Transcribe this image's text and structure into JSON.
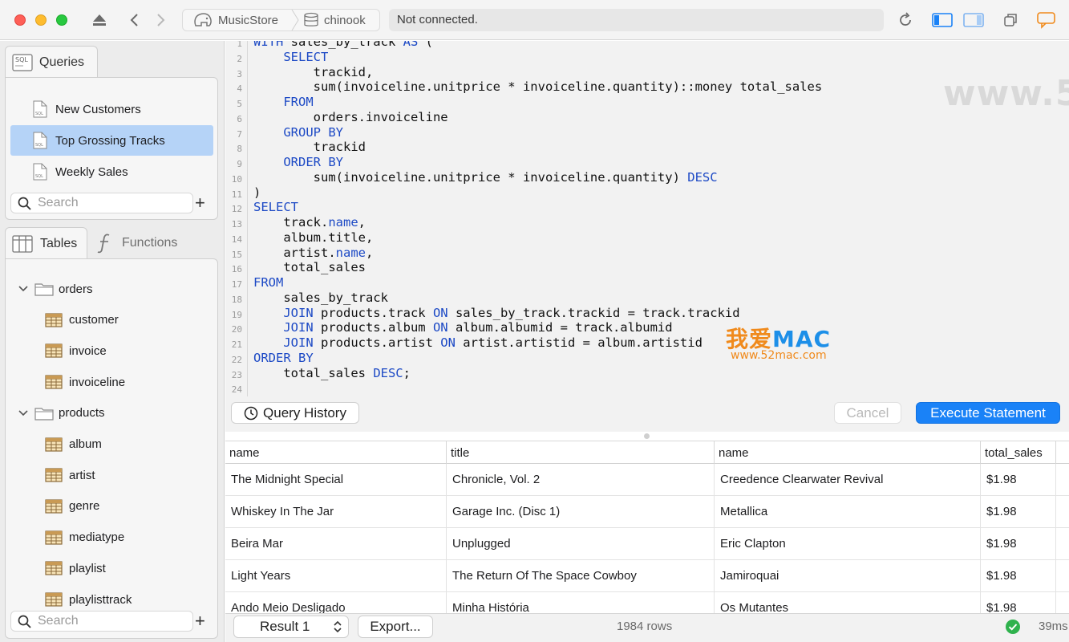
{
  "toolbar": {
    "breadcrumb": {
      "server": "MusicStore",
      "database": "chinook"
    },
    "status": "Not connected."
  },
  "watermarks": {
    "site": "www.52mac.com",
    "logo_cn": "我爱",
    "logo_en": "MAC",
    "logo_sub": "www.52mac.com"
  },
  "sidebar": {
    "queries_tab": "Queries",
    "queries": [
      {
        "label": "New Customers",
        "selected": false
      },
      {
        "label": "Top Grossing Tracks",
        "selected": true
      },
      {
        "label": "Weekly Sales",
        "selected": false
      }
    ],
    "queries_search_placeholder": "Search",
    "tables_tab": "Tables",
    "functions_tab": "Functions",
    "tree": [
      {
        "type": "folder",
        "label": "orders"
      },
      {
        "type": "table",
        "label": "customer"
      },
      {
        "type": "table",
        "label": "invoice"
      },
      {
        "type": "table",
        "label": "invoiceline"
      },
      {
        "type": "folder",
        "label": "products"
      },
      {
        "type": "table",
        "label": "album"
      },
      {
        "type": "table",
        "label": "artist"
      },
      {
        "type": "table",
        "label": "genre"
      },
      {
        "type": "table",
        "label": "mediatype"
      },
      {
        "type": "table",
        "label": "playlist"
      },
      {
        "type": "table",
        "label": "playlisttrack"
      }
    ],
    "tables_search_placeholder": "Search"
  },
  "editor": {
    "line_numbers": [
      "1",
      "2",
      "3",
      "4",
      "5",
      "6",
      "7",
      "8",
      "9",
      "10",
      "11",
      "12",
      "13",
      "14",
      "15",
      "16",
      "17",
      "18",
      "19",
      "20",
      "21",
      "22",
      "23",
      "24"
    ],
    "lines": [
      [
        {
          "t": "WITH",
          "k": true
        },
        {
          "t": " sales_by_track "
        },
        {
          "t": "AS",
          "k": true
        },
        {
          "t": " ("
        }
      ],
      [
        {
          "t": "    "
        },
        {
          "t": "SELECT",
          "k": true
        }
      ],
      [
        {
          "t": "        trackid,"
        }
      ],
      [
        {
          "t": "        sum(invoiceline.unitprice * invoiceline.quantity)::money total_sales"
        }
      ],
      [
        {
          "t": "    "
        },
        {
          "t": "FROM",
          "k": true
        }
      ],
      [
        {
          "t": "        orders.invoiceline"
        }
      ],
      [
        {
          "t": "    "
        },
        {
          "t": "GROUP BY",
          "k": true
        }
      ],
      [
        {
          "t": "        trackid"
        }
      ],
      [
        {
          "t": "    "
        },
        {
          "t": "ORDER BY",
          "k": true
        }
      ],
      [
        {
          "t": "        sum(invoiceline.unitprice * invoiceline.quantity) "
        },
        {
          "t": "DESC",
          "k": true
        }
      ],
      [
        {
          "t": ")"
        }
      ],
      [
        {
          "t": "SELECT",
          "k": true
        }
      ],
      [
        {
          "t": "    track."
        },
        {
          "t": "name",
          "k": true
        },
        {
          "t": ","
        }
      ],
      [
        {
          "t": "    album.title,"
        }
      ],
      [
        {
          "t": "    artist."
        },
        {
          "t": "name",
          "k": true
        },
        {
          "t": ","
        }
      ],
      [
        {
          "t": "    total_sales"
        }
      ],
      [
        {
          "t": "FROM",
          "k": true
        }
      ],
      [
        {
          "t": "    sales_by_track"
        }
      ],
      [
        {
          "t": "    "
        },
        {
          "t": "JOIN",
          "k": true
        },
        {
          "t": " products.track "
        },
        {
          "t": "ON",
          "k": true
        },
        {
          "t": " sales_by_track.trackid = track.trackid"
        }
      ],
      [
        {
          "t": "    "
        },
        {
          "t": "JOIN",
          "k": true
        },
        {
          "t": " products.album "
        },
        {
          "t": "ON",
          "k": true
        },
        {
          "t": " album.albumid = track.albumid"
        }
      ],
      [
        {
          "t": "    "
        },
        {
          "t": "JOIN",
          "k": true
        },
        {
          "t": " products.artist "
        },
        {
          "t": "ON",
          "k": true
        },
        {
          "t": " artist.artistid = album.artistid"
        }
      ],
      [
        {
          "t": "ORDER BY",
          "k": true
        }
      ],
      [
        {
          "t": "    total_sales "
        },
        {
          "t": "DESC",
          "k": true
        },
        {
          "t": ";"
        }
      ],
      [
        {
          "t": ""
        }
      ]
    ]
  },
  "actions": {
    "history": "Query History",
    "cancel": "Cancel",
    "execute": "Execute Statement"
  },
  "results": {
    "columns": [
      "name",
      "title",
      "name",
      "total_sales"
    ],
    "rows": [
      [
        "The Midnight Special",
        "Chronicle, Vol. 2",
        "Creedence Clearwater Revival",
        "$1.98"
      ],
      [
        "Whiskey In The Jar",
        "Garage Inc. (Disc 1)",
        "Metallica",
        "$1.98"
      ],
      [
        "Beira Mar",
        "Unplugged",
        "Eric Clapton",
        "$1.98"
      ],
      [
        "Light Years",
        "The Return Of The Space Cowboy",
        "Jamiroquai",
        "$1.98"
      ],
      [
        "Ando Meio Desligado",
        "Minha História",
        "Os Mutantes",
        "$1.98"
      ]
    ]
  },
  "bottombar": {
    "result_select": "Result 1",
    "export": "Export...",
    "row_count": "1984 rows",
    "duration": "39ms"
  },
  "colors": {
    "accent": "#1a82f7",
    "keyword": "#1c49c5",
    "selection": "#b5d3f7",
    "success": "#2fb24d"
  }
}
